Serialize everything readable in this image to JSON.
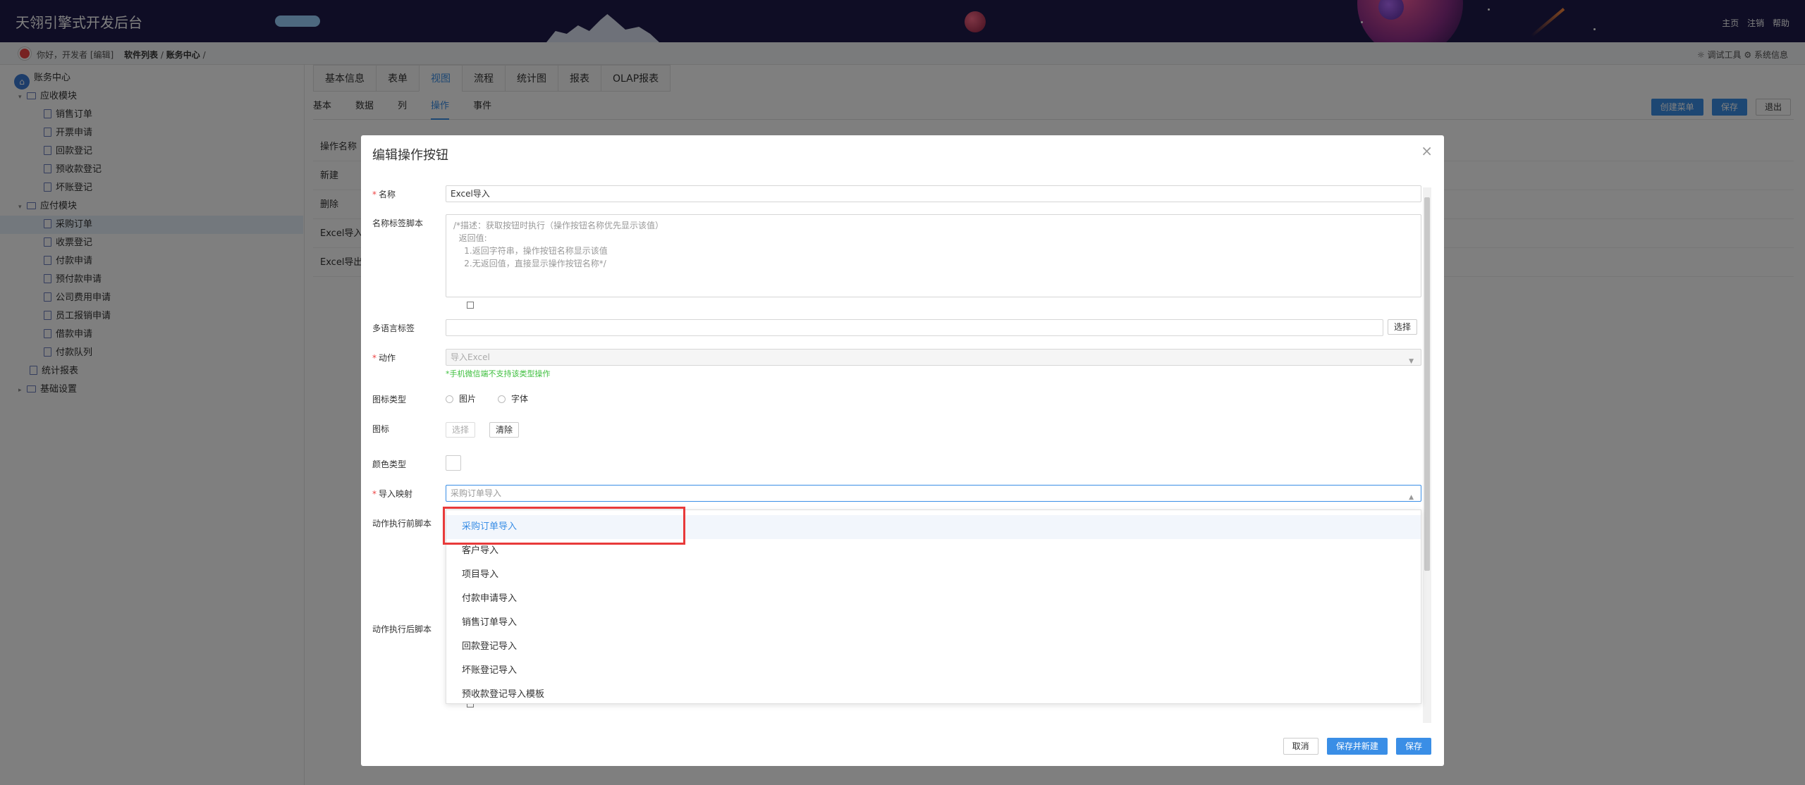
{
  "header": {
    "app_title": "天翎引擎式开发后台",
    "links": [
      "主页",
      "注销",
      "帮助"
    ]
  },
  "breadcrumb": {
    "greeting": "你好，开发者 [编辑]",
    "path_1": "软件列表",
    "path_2": "账务中心",
    "sep": "/",
    "tools_1": "调试工具",
    "tools_2": "系统信息"
  },
  "sidebar": {
    "root": "账务中心",
    "groups": [
      {
        "label": "应收模块",
        "items": [
          "销售订单",
          "开票申请",
          "回款登记",
          "预收款登记",
          "坏账登记"
        ]
      },
      {
        "label": "应付模块",
        "items": [
          "采购订单",
          "收票登记",
          "付款申请",
          "预付款申请",
          "公司费用申请",
          "员工报销申请",
          "借款申请",
          "付款队列"
        ]
      }
    ],
    "extra": "统计报表",
    "settings": "基础设置",
    "selected": "采购订单"
  },
  "main": {
    "tabs": [
      "基本信息",
      "表单",
      "视图",
      "流程",
      "统计图",
      "报表",
      "OLAP报表"
    ],
    "active_tab": "视图",
    "subtabs": [
      "基本",
      "数据",
      "列",
      "操作",
      "事件"
    ],
    "active_subtab": "操作",
    "buttons": {
      "create_menu": "创建菜单",
      "save": "保存",
      "exit": "退出"
    },
    "rows": [
      "操作名称",
      "新建",
      "删除",
      "Excel导入",
      "Excel导出"
    ]
  },
  "dialog": {
    "title": "编辑操作按钮",
    "close": "×",
    "name_label": "名称",
    "name_value": "Excel导入",
    "script_label": "名称标签脚本",
    "script_placeholder": "/*描述：获取按钮时执行（操作按钮名称优先显示该值）\n  返回值:\n    1.返回字符串，操作按钮名称显示该值\n    2.无返回值，直接显示操作按钮名称*/",
    "multilang_label": "多语言标签",
    "select_btn": "选择",
    "action_label": "动作",
    "action_value": "导入Excel",
    "action_tip": "*手机微信端不支持该类型操作",
    "icon_type_label": "图标类型",
    "icon_type_opt1": "图片",
    "icon_type_opt2": "字体",
    "icon_label": "图标",
    "icon_select": "选择",
    "icon_clear": "清除",
    "color_label": "颜色类型",
    "mapping_label": "导入映射",
    "mapping_value": "采购订单导入",
    "pre_script_label": "动作执行前脚本",
    "post_script_label": "动作执行后脚本",
    "footer": {
      "cancel": "取消",
      "save_new": "保存并新建",
      "save": "保存"
    }
  },
  "dropdown": {
    "options": [
      "采购订单导入",
      "客户导入",
      "项目导入",
      "付款申请导入",
      "销售订单导入",
      "回款登记导入",
      "坏账登记导入",
      "预收款登记导入模板"
    ],
    "selected": "采购订单导入"
  }
}
